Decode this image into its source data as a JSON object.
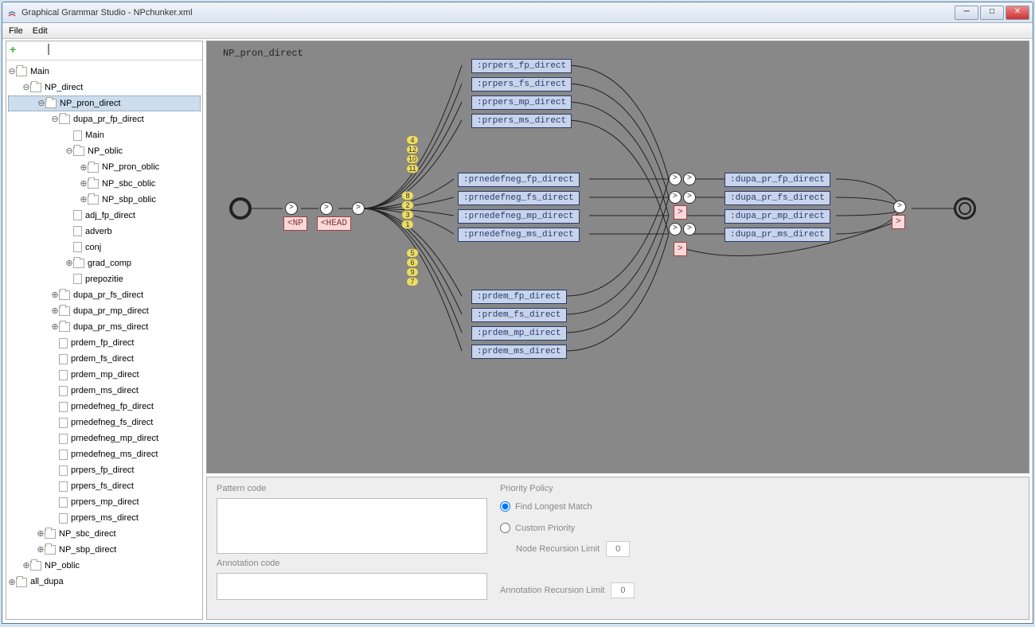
{
  "window": {
    "title": "Graphical Grammar Studio - NPchunker.xml"
  },
  "menu": {
    "file": "File",
    "edit": "Edit"
  },
  "tree": [
    {
      "d": 0,
      "t": "folder",
      "exp": "⊖",
      "label": "Main"
    },
    {
      "d": 1,
      "t": "folder",
      "exp": "⊖",
      "label": "NP_direct"
    },
    {
      "d": 2,
      "t": "folder",
      "exp": "⊖",
      "label": "NP_pron_direct",
      "sel": true
    },
    {
      "d": 3,
      "t": "folder",
      "exp": "⊖",
      "label": "dupa_pr_fp_direct"
    },
    {
      "d": 4,
      "t": "file",
      "label": "Main"
    },
    {
      "d": 4,
      "t": "folder",
      "exp": "⊖",
      "label": "NP_oblic"
    },
    {
      "d": 5,
      "t": "folder",
      "exp": "⊕",
      "label": "NP_pron_oblic"
    },
    {
      "d": 5,
      "t": "folder",
      "exp": "⊕",
      "label": "NP_sbc_oblic"
    },
    {
      "d": 5,
      "t": "folder",
      "exp": "⊕",
      "label": "NP_sbp_oblic"
    },
    {
      "d": 4,
      "t": "file",
      "label": "adj_fp_direct"
    },
    {
      "d": 4,
      "t": "file",
      "label": "adverb"
    },
    {
      "d": 4,
      "t": "file",
      "label": "conj"
    },
    {
      "d": 4,
      "t": "folder",
      "exp": "⊕",
      "label": "grad_comp"
    },
    {
      "d": 4,
      "t": "file",
      "label": "prepozitie"
    },
    {
      "d": 3,
      "t": "folder",
      "exp": "⊕",
      "label": "dupa_pr_fs_direct"
    },
    {
      "d": 3,
      "t": "folder",
      "exp": "⊕",
      "label": "dupa_pr_mp_direct"
    },
    {
      "d": 3,
      "t": "folder",
      "exp": "⊕",
      "label": "dupa_pr_ms_direct"
    },
    {
      "d": 3,
      "t": "file",
      "label": "prdem_fp_direct"
    },
    {
      "d": 3,
      "t": "file",
      "label": "prdem_fs_direct"
    },
    {
      "d": 3,
      "t": "file",
      "label": "prdem_mp_direct"
    },
    {
      "d": 3,
      "t": "file",
      "label": "prdem_ms_direct"
    },
    {
      "d": 3,
      "t": "file",
      "label": "prnedefneg_fp_direct"
    },
    {
      "d": 3,
      "t": "file",
      "label": "prnedefneg_fs_direct"
    },
    {
      "d": 3,
      "t": "file",
      "label": "prnedefneg_mp_direct"
    },
    {
      "d": 3,
      "t": "file",
      "label": "prnedefneg_ms_direct"
    },
    {
      "d": 3,
      "t": "file",
      "label": "prpers_fp_direct"
    },
    {
      "d": 3,
      "t": "file",
      "label": "prpers_fs_direct"
    },
    {
      "d": 3,
      "t": "file",
      "label": "prpers_mp_direct"
    },
    {
      "d": 3,
      "t": "file",
      "label": "prpers_ms_direct"
    },
    {
      "d": 2,
      "t": "folder",
      "exp": "⊕",
      "label": "NP_sbc_direct"
    },
    {
      "d": 2,
      "t": "folder",
      "exp": "⊕",
      "label": "NP_sbp_direct"
    },
    {
      "d": 1,
      "t": "folder",
      "exp": "⊕",
      "label": "NP_oblic"
    },
    {
      "d": 0,
      "t": "folder",
      "exp": "⊕",
      "label": "all_dupa"
    }
  ],
  "canvas": {
    "title": "NP_pron_direct",
    "tags": {
      "np": "<NP",
      "head": "<HEAD",
      "close": ">"
    },
    "nums": [
      "4",
      "12",
      "10",
      "11",
      "8",
      "2",
      "3",
      "1",
      "5",
      "6",
      "9",
      "7"
    ],
    "group1": [
      ":prpers_fp_direct",
      ":prpers_fs_direct",
      ":prpers_mp_direct",
      ":prpers_ms_direct"
    ],
    "group2": [
      ":prnedefneg_fp_direct",
      ":prnedefneg_fs_direct",
      ":prnedefneg_mp_direct",
      ":prnedefneg_ms_direct"
    ],
    "group3": [
      ":prdem_fp_direct",
      ":prdem_fs_direct",
      ":prdem_mp_direct",
      ":prdem_ms_direct"
    ],
    "group4": [
      ":dupa_pr_fp_direct",
      ":dupa_pr_fs_direct",
      ":dupa_pr_mp_direct",
      ":dupa_pr_ms_direct"
    ]
  },
  "props": {
    "pattern_label": "Pattern code",
    "annotation_label": "Annotation code",
    "priority_label": "Priority Policy",
    "longest": "Find Longest Match",
    "custom": "Custom Priority",
    "node_limit_label": "Node Recursion Limit",
    "anno_limit_label": "Annotation Recursion Limit",
    "limit_placeholder": "0"
  }
}
